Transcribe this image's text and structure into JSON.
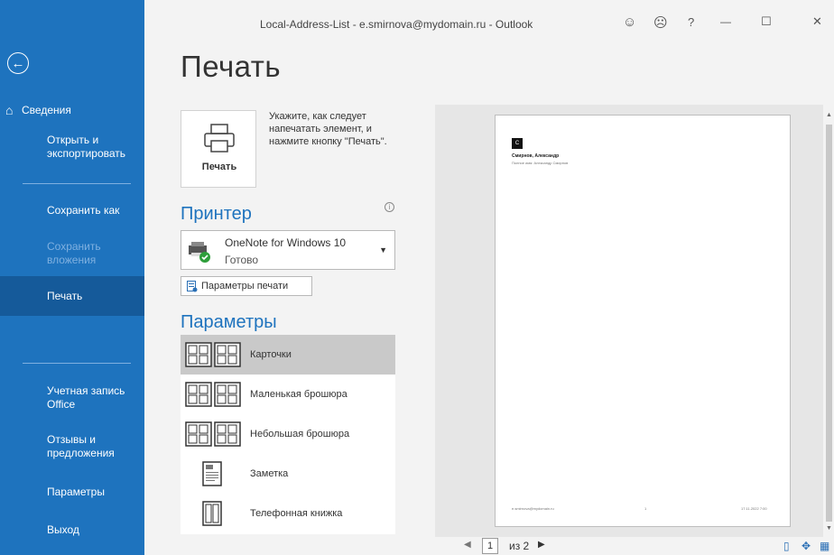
{
  "window": {
    "title": "Local-Address-List - e.smirnova@mydomain.ru - Outlook",
    "smiley": "☺",
    "frown": "☹",
    "help": "?",
    "minimize": "—",
    "maximize": "☐",
    "close": "✕"
  },
  "sidebar": {
    "back_glyph": "←",
    "info": "Сведения",
    "open_export": "Открыть и экспортировать",
    "save_as": "Сохранить как",
    "save_attachments": "Сохранить вложения",
    "print": "Печать",
    "office_account": "Учетная запись Office",
    "feedback": "Отзывы и предложения",
    "options": "Параметры",
    "exit": "Выход"
  },
  "page_title": "Печать",
  "print_button": {
    "label": "Печать",
    "description": "Укажите, как следует напечатать элемент, и нажмите кнопку \"Печать\"."
  },
  "printer": {
    "heading": "Принтер",
    "info_glyph": "i",
    "name": "OneNote for Windows 10",
    "status": "Готово",
    "caret": "▼",
    "properties_label": "Параметры печати"
  },
  "settings": {
    "heading": "Параметры",
    "styles": [
      {
        "label": "Карточки",
        "selected": true
      },
      {
        "label": "Маленькая брошюра",
        "selected": false
      },
      {
        "label": "Небольшая брошюра",
        "selected": false
      },
      {
        "label": "Заметка",
        "selected": false
      },
      {
        "label": "Телефонная книжка",
        "selected": false
      }
    ]
  },
  "preview": {
    "letter": "С",
    "contact_name": "Смирнов, Александр",
    "contact_line": "Полное имя:    Александр Смирнов",
    "footer_left": "e.smirnova@mydomain.ru",
    "footer_mid": "1",
    "footer_right": "17.11.2022 7:00",
    "page_current": "1",
    "page_of": "из 2",
    "prev_glyph": "◀",
    "next_glyph": "▶"
  },
  "colors": {
    "sidebar": "#1e73be",
    "accent": "#1e73be",
    "selected_style": "#c9c9c9"
  }
}
